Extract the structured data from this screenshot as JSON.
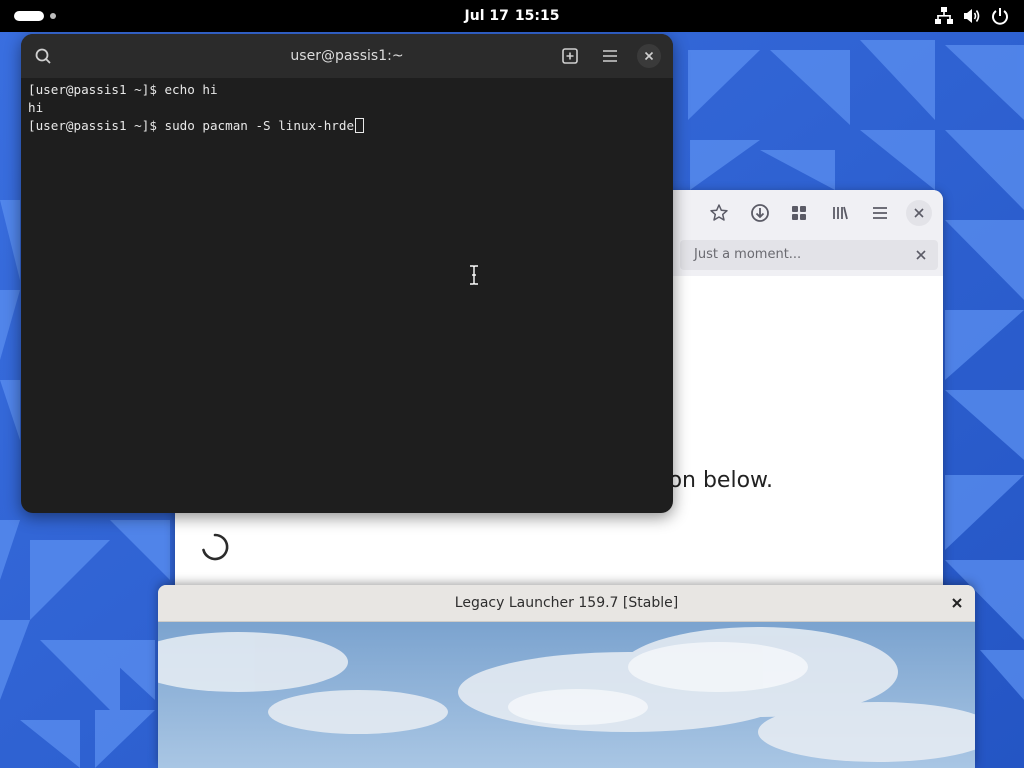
{
  "topbar": {
    "clock_date": "Jul 17",
    "clock_time": "15:15",
    "icons": [
      "network-icon",
      "volume-icon",
      "power-icon"
    ]
  },
  "terminal": {
    "title": "user@passis1:~",
    "lines": [
      "[user@passis1 ~]$ echo hi",
      "hi"
    ],
    "current_prompt": "[user@passis1 ~]$ ",
    "current_input": "sudo pacman -S linux-hrde"
  },
  "browser": {
    "tab_title": "Just a moment...",
    "visible_text": "on below.",
    "toolbar_icons": [
      "star-icon",
      "download-icon",
      "extensions-icon",
      "library-icon",
      "menu-icon",
      "close-icon"
    ]
  },
  "launcher": {
    "title": "Legacy Launcher 159.7 [Stable]"
  },
  "colors": {
    "wallpaper": "#2f63d3",
    "terminal_bg": "#1e1e1e",
    "terminal_header": "#2b2b2b",
    "topbar": "#000000"
  }
}
